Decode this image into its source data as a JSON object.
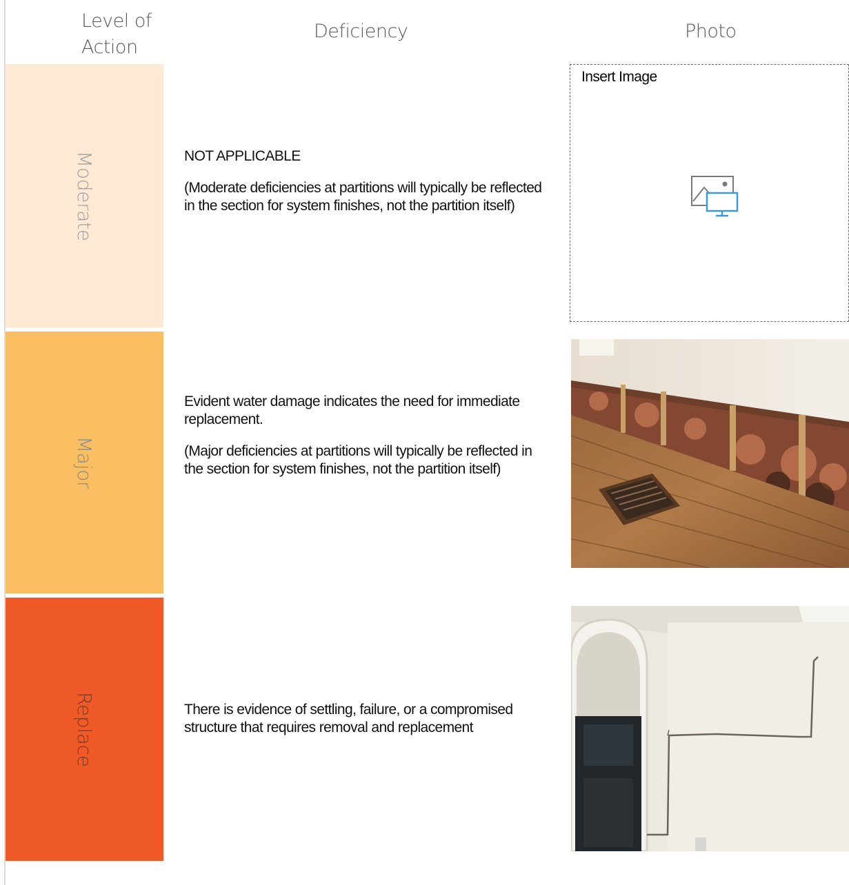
{
  "header": {
    "level_label": "Level of Action",
    "deficiency_label": "Deficiency",
    "photo_label": "Photo"
  },
  "rows": [
    {
      "level": "Moderate",
      "level_color": "#fde9d4",
      "level_text_color": "#a0a0a0",
      "title": "NOT APPLICABLE",
      "note": "(Moderate deficiencies at partitions will typically be reflected in the section for system finishes, not the partition itself)"
    },
    {
      "level": "Major",
      "level_color": "#fabf62",
      "level_text_color": "#8a8a8a",
      "title": "Evident water damage indicates the need for immediate replacement.",
      "note": "(Major deficiencies at partitions will typically be reflected in the section for system finishes, not the partition itself)"
    },
    {
      "level": "Replace",
      "level_color": "#f05a28",
      "level_text_color": "#7a3b22",
      "title": "There is evidence of settling, failure, or a compromised structure that requires removal and replacement"
    }
  ],
  "photo_placeholder": {
    "label": "Insert Image",
    "icon": "insert-picture-icon"
  }
}
